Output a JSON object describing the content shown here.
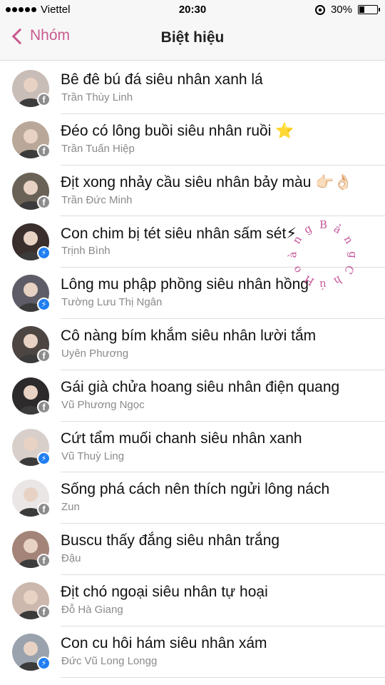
{
  "status": {
    "carrier": "Viettel",
    "time": "20:30",
    "battery": "30%",
    "battery_level": 0.3
  },
  "nav": {
    "back_label": "Nhóm",
    "title": "Biệt hiệu"
  },
  "watermark_letters": [
    "B",
    "ả",
    "n",
    "g",
    "C",
    "h",
    "ú",
    "H",
    "o",
    "à",
    "n",
    "g"
  ],
  "members": [
    {
      "nickname": "Bê đê bú đá siêu nhân xanh lá",
      "name": "Trần Thùy Linh",
      "badge": "facebook-icon",
      "avatar_color": "#c9bdb7"
    },
    {
      "nickname": "Đéo có lông buồi siêu nhân ruồi ⭐",
      "name": "Trần Tuấn Hiệp",
      "badge": "facebook-icon",
      "avatar_color": "#b9a899"
    },
    {
      "nickname": "Địt xong nhảy cầu siêu nhân bảy màu 👉🏻👌🏻",
      "name": "Trần Đức Minh",
      "badge": "facebook-icon",
      "avatar_color": "#6b6257"
    },
    {
      "nickname": "Con chim bị tét siêu nhân sấm sét⚡",
      "name": "Trịnh Bình",
      "badge": "messenger-icon",
      "avatar_color": "#3a2f2c"
    },
    {
      "nickname": "Lông mu phập phồng siêu nhân hồng",
      "name": "Tường Lưu Thị Ngân",
      "badge": "messenger-icon",
      "avatar_color": "#5e5c66"
    },
    {
      "nickname": "Cô nàng bím khắm siêu nhân lười tắm",
      "name": "Uyên Phương",
      "badge": "facebook-icon",
      "avatar_color": "#4c4542"
    },
    {
      "nickname": "Gái già chửa hoang siêu nhân điện quang",
      "name": "Vũ Phương Ngọc",
      "badge": "facebook-icon",
      "avatar_color": "#2c2a2b"
    },
    {
      "nickname": "Cứt tẩm muối chanh siêu nhân xanh",
      "name": "Vũ Thuỳ Ling",
      "badge": "messenger-icon",
      "avatar_color": "#d8cfcb"
    },
    {
      "nickname": "Sống phá cách nên thích ngửi lông nách",
      "name": "Zun",
      "badge": "facebook-icon",
      "avatar_color": "#e9e6e5"
    },
    {
      "nickname": "Buscu thấy đắng siêu nhân trắng",
      "name": "Đậu",
      "badge": "facebook-icon",
      "avatar_color": "#a48478"
    },
    {
      "nickname": "Địt chó ngoại siêu nhân tự hoại",
      "name": "Đỗ Hà Giang",
      "badge": "facebook-icon",
      "avatar_color": "#cdb8ae"
    },
    {
      "nickname": "Con cu hôi hám siêu nhân xám",
      "name": "Đức Vũ Long Longg",
      "badge": "messenger-icon",
      "avatar_color": "#9aa3ad"
    }
  ]
}
